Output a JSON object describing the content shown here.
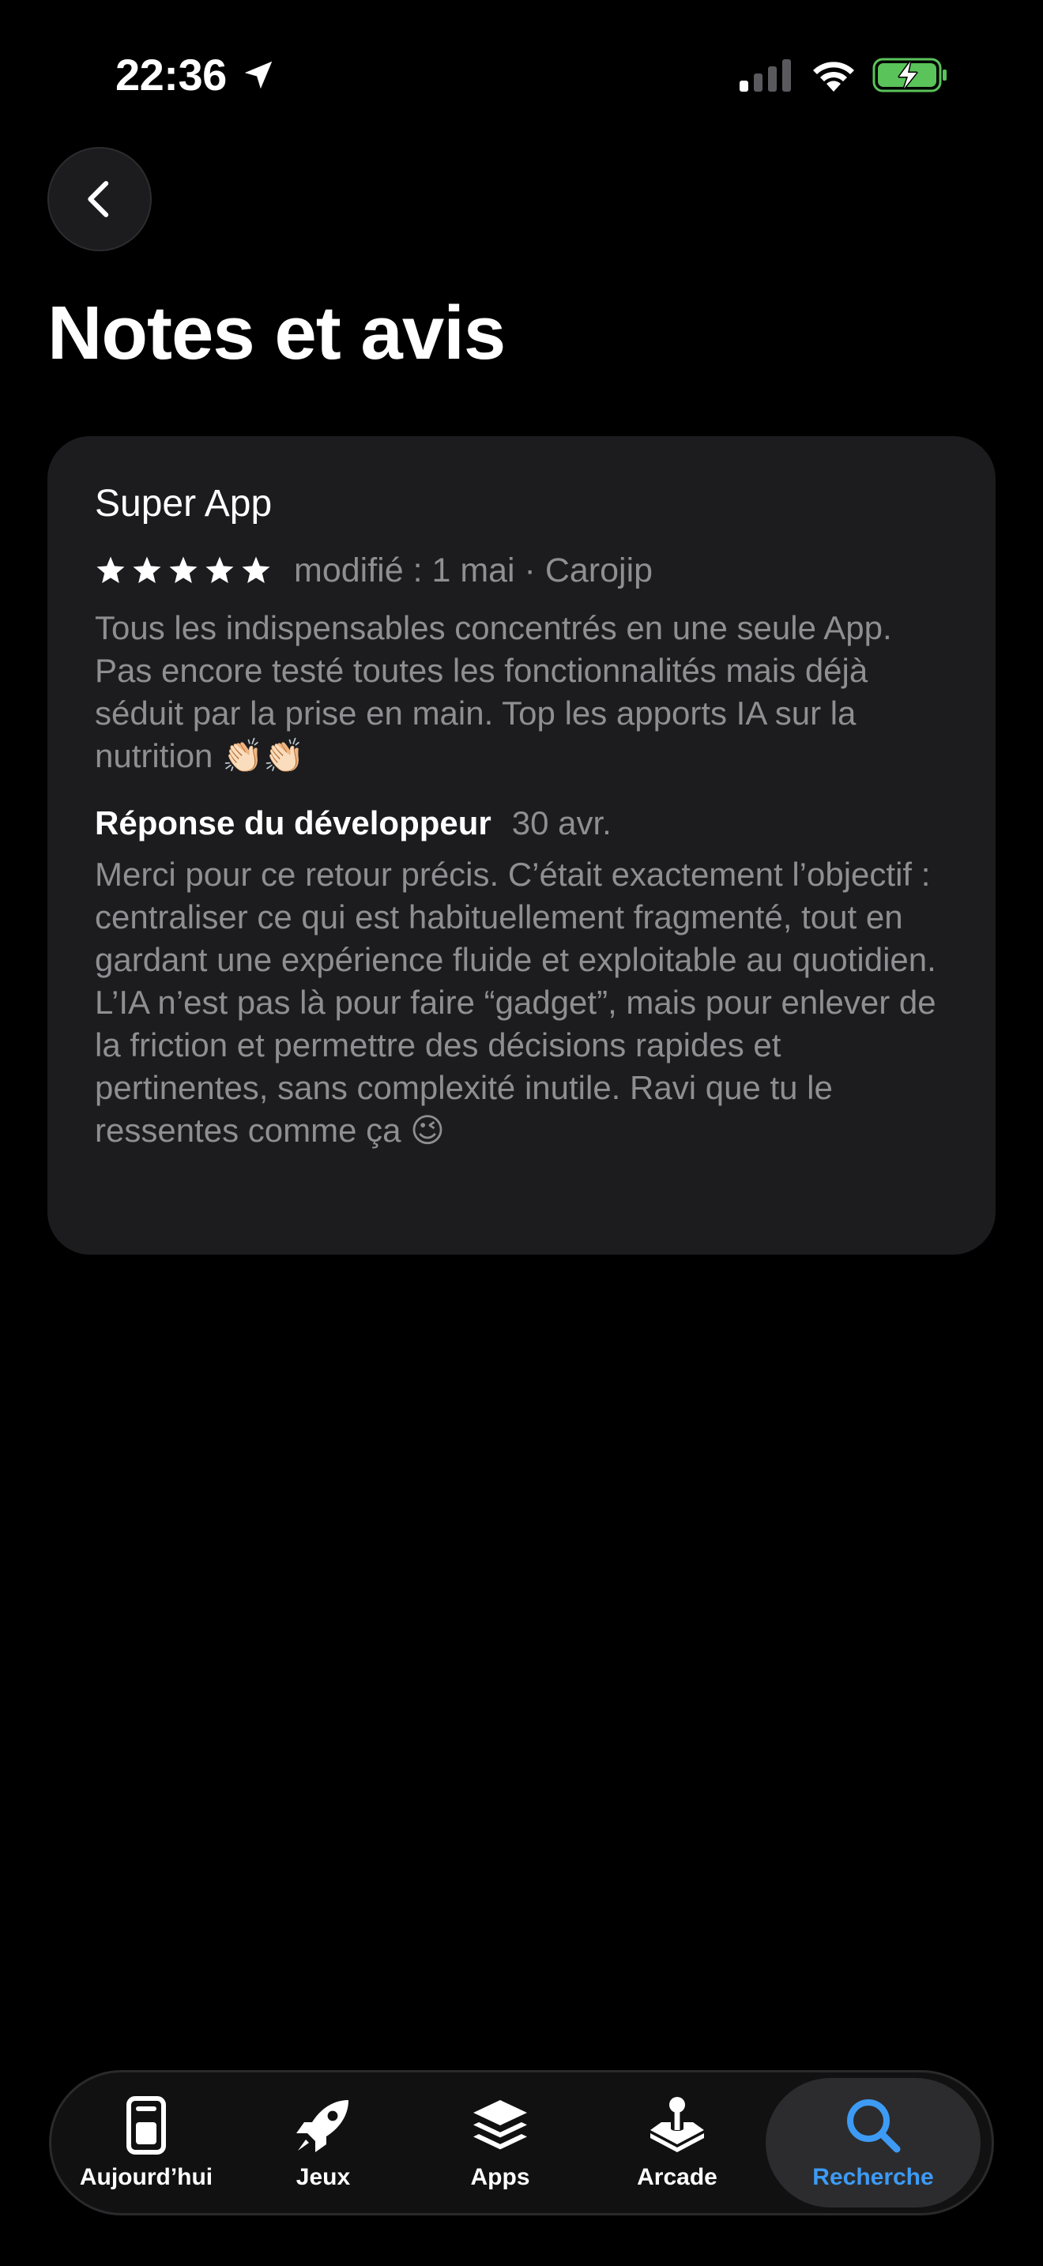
{
  "status_bar": {
    "time": "22:36",
    "icons": [
      "location-arrow-icon",
      "cellular-signal-icon",
      "wifi-icon",
      "battery-charging-icon"
    ],
    "battery_color": "#5ac35a"
  },
  "header": {
    "back_icon": "chevron-left-icon",
    "title": "Notes et avis"
  },
  "review": {
    "title": "Super App",
    "rating": 5,
    "rating_max": 5,
    "meta": "modifié : 1 mai · Carojip",
    "body": "Tous les indispensables concentrés en une seule App. Pas encore testé toutes les fonctionnalités mais déjà séduit par la prise en main. Top les apports IA sur la nutrition 👏🏻👏🏻",
    "developer_response": {
      "label": "Réponse du développeur",
      "date": "30 avr.",
      "body": "Merci pour ce retour précis. C’était exactement l’objectif : centraliser ce qui est habituellement fragmenté, tout en gardant une expérience fluide et exploitable au quotidien. L’IA n’est pas là pour faire “gadget”, mais pour enlever de la friction et permettre des décisions rapides et pertinentes, sans complexité inutile. Ravi que tu le ressentes comme ça 😉"
    }
  },
  "tab_bar": {
    "tabs": [
      {
        "label": "Aujourd’hui",
        "icon": "today-icon"
      },
      {
        "label": "Jeux",
        "icon": "rocket-icon"
      },
      {
        "label": "Apps",
        "icon": "layers-icon"
      },
      {
        "label": "Arcade",
        "icon": "joystick-icon"
      },
      {
        "label": "Recherche",
        "icon": "search-icon",
        "active": true
      }
    ],
    "active_color": "#3d9bf5"
  }
}
